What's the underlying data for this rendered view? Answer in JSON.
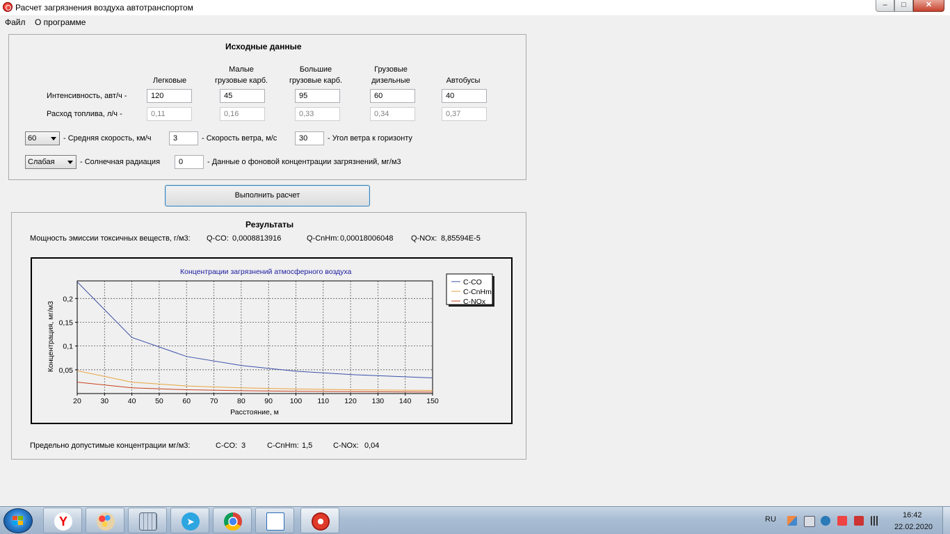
{
  "window": {
    "title": "Расчет загрязнения воздуха автотранспортом",
    "min": "–",
    "max": "□",
    "close": "✕"
  },
  "menu": [
    "Файл",
    "О программе"
  ],
  "input": {
    "title": "Исходные данные",
    "columns": [
      [
        "",
        "Легковые"
      ],
      [
        "Малые",
        "грузовые карб."
      ],
      [
        "Большие",
        "грузовые карб."
      ],
      [
        "Грузовые",
        "дизельные"
      ],
      [
        "",
        "Автобусы"
      ]
    ],
    "intensity_label": "Интенсивность, авт/ч -",
    "intensity": [
      "120",
      "45",
      "95",
      "60",
      "40"
    ],
    "fuel_label": "Расход топлива, л/ч -",
    "fuel": [
      "0,11",
      "0,16",
      "0,33",
      "0,34",
      "0,37"
    ],
    "speed_select": "60",
    "speed_label": "- Средняя скорость, км/ч",
    "wind_speed": "3",
    "wind_speed_label": "- Скорость ветра, м/с",
    "wind_angle": "30",
    "wind_angle_label": "- Угол ветра к горизонту",
    "radiation_select": "Слабая",
    "radiation_label": "- Солнечная радиация",
    "background": "0",
    "background_label": "- Данные о фоновой концентрации загрязнений, мг/м3"
  },
  "calc_button": "Выполнить расчет",
  "results": {
    "title": "Результаты",
    "emission_label": "Мощность эмиссии токсичных веществ, г/м3:",
    "q_co_label": "Q-CO:",
    "q_co": "0,0008813916",
    "q_cnhm_label": "Q-CnHm:",
    "q_cnhm": "0,00018006048",
    "q_nox_label": "Q-NOx:",
    "q_nox": "8,85594E-5",
    "mpc_label": "Предельно допустимые концентрации мг/м3:",
    "c_co_label": "C-CO:",
    "c_co": "3",
    "c_cnhm_label": "C-CnHm:",
    "c_cnhm": "1,5",
    "c_nox_label": "C-NOx:",
    "c_nox": "0,04"
  },
  "chart_data": {
    "type": "line",
    "title": "Концентрации загрязнений атмосферного воздуха",
    "xlabel": "Расстояние, м",
    "ylabel": "Концентрация, мг/м3",
    "xlim": [
      20,
      150
    ],
    "ylim": [
      0,
      0.237
    ],
    "x_ticks": [
      20,
      30,
      40,
      50,
      60,
      70,
      80,
      90,
      100,
      110,
      120,
      130,
      140,
      150
    ],
    "y_ticks": [
      0.05,
      0.1,
      0.15,
      0.2
    ],
    "y_tick_labels": [
      "0,05",
      "0,1",
      "0,15",
      "0,2"
    ],
    "grid": true,
    "legend_position": "top-right",
    "x": [
      20,
      40,
      60,
      80,
      100,
      120,
      150
    ],
    "series": [
      {
        "name": "C-CO",
        "color": "#3a4fa8",
        "values": [
          0.235,
          0.118,
          0.078,
          0.059,
          0.047,
          0.04,
          0.033
        ]
      },
      {
        "name": "C-CnHm",
        "color": "#e8a33c",
        "values": [
          0.048,
          0.024,
          0.016,
          0.012,
          0.0097,
          0.008,
          0.0065
        ]
      },
      {
        "name": "C-NOx",
        "color": "#c8401e",
        "values": [
          0.024,
          0.012,
          0.008,
          0.006,
          0.0048,
          0.004,
          0.0032
        ]
      }
    ]
  },
  "taskbar": {
    "lang": "RU",
    "time": "16:42",
    "date": "22.02.2020"
  }
}
